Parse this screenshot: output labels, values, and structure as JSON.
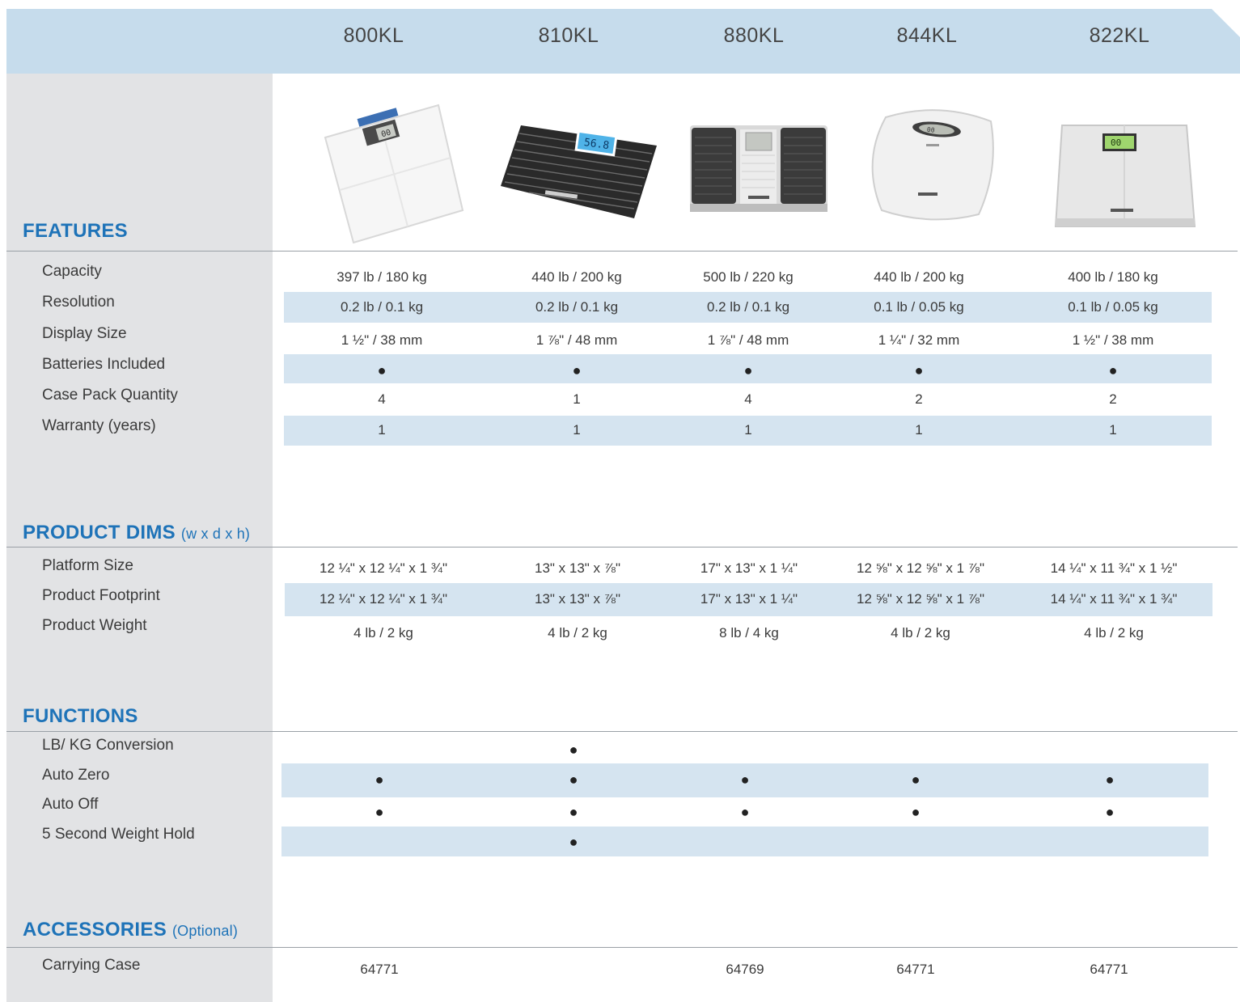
{
  "models": [
    "800KL",
    "810KL",
    "880KL",
    "844KL",
    "822KL"
  ],
  "sections": {
    "features": {
      "title": "FEATURES",
      "sub": ""
    },
    "dims": {
      "title": "PRODUCT DIMS",
      "sub": "(w x d x h)"
    },
    "functions": {
      "title": "FUNCTIONS",
      "sub": ""
    },
    "accessories": {
      "title": "ACCESSORIES",
      "sub": "(Optional)"
    }
  },
  "features": [
    {
      "label": "Capacity",
      "values": [
        "397 lb / 180 kg",
        "440 lb / 200 kg",
        "500 lb / 220 kg",
        "440 lb / 200 kg",
        "400 lb / 180 kg"
      ]
    },
    {
      "label": "Resolution",
      "values": [
        "0.2 lb / 0.1 kg",
        "0.2 lb / 0.1 kg",
        "0.2 lb / 0.1 kg",
        "0.1 lb / 0.05 kg",
        "0.1 lb / 0.05 kg"
      ]
    },
    {
      "label": "Display Size",
      "values": [
        "1 ½\" / 38 mm",
        "1 ⅞\" / 48 mm",
        "1 ⅞\" / 48 mm",
        "1 ¼\" / 32 mm",
        "1 ½\" / 38 mm"
      ]
    },
    {
      "label": "Batteries Included",
      "values": [
        "●",
        "●",
        "●",
        "●",
        "●"
      ]
    },
    {
      "label": "Case Pack Quantity",
      "values": [
        "4",
        "1",
        "4",
        "2",
        "2"
      ]
    },
    {
      "label": "Warranty (years)",
      "values": [
        "1",
        "1",
        "1",
        "1",
        "1"
      ]
    }
  ],
  "dims": [
    {
      "label": "Platform Size",
      "values": [
        "12 ¼\" x 12 ¼\" x 1 ¾\"",
        "13\" x 13\" x ⅞\"",
        "17\" x 13\" x 1 ¼\"",
        "12 ⅝\" x 12 ⅝\" x 1 ⅞\"",
        "14 ¼\" x 11 ¾\" x 1 ½\""
      ]
    },
    {
      "label": "Product Footprint",
      "values": [
        "12 ¼\" x 12 ¼\" x 1 ¾\"",
        "13\" x 13\" x ⅞\"",
        "17\" x 13\" x 1 ¼\"",
        "12 ⅝\" x 12 ⅝\" x 1 ⅞\"",
        "14 ¼\" x 11 ¾\" x 1 ¾\""
      ]
    },
    {
      "label": "Product Weight",
      "values": [
        "4 lb / 2 kg",
        "4 lb / 2 kg",
        "8 lb / 4 kg",
        "4 lb / 2 kg",
        "4 lb / 2 kg"
      ]
    }
  ],
  "functions": [
    {
      "label": "LB/ KG Conversion",
      "values": [
        "",
        "●",
        "",
        "",
        ""
      ]
    },
    {
      "label": "Auto Zero",
      "values": [
        "●",
        "●",
        "●",
        "●",
        "●"
      ]
    },
    {
      "label": "Auto Off",
      "values": [
        "●",
        "●",
        "●",
        "●",
        "●"
      ]
    },
    {
      "label": "5 Second Weight Hold",
      "values": [
        "",
        "●",
        "",
        "",
        ""
      ]
    }
  ],
  "accessories": [
    {
      "label": "Carrying Case",
      "values": [
        "64771",
        "",
        "64769",
        "64771",
        "64771"
      ]
    }
  ],
  "displays": {
    "m800": "00",
    "m810": "56.8",
    "m844": "00",
    "m822": "00"
  }
}
